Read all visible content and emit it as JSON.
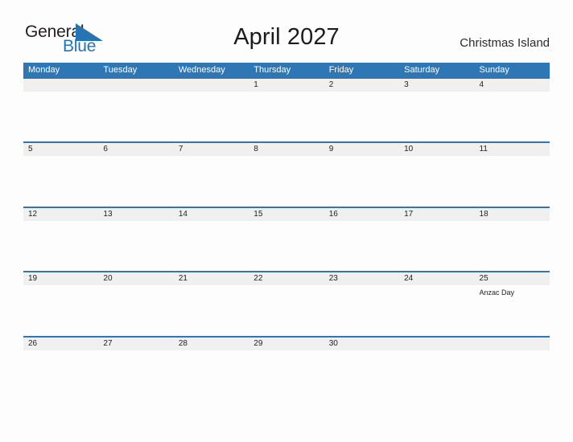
{
  "brand": {
    "name_part1": "General",
    "name_part2": "Blue",
    "flag_icon": "blue-triangle-flag",
    "accent_color": "#2874b2"
  },
  "header": {
    "title": "April 2027",
    "region": "Christmas Island"
  },
  "calendar": {
    "month": "April",
    "year": "2027",
    "header_color": "#2e76b4",
    "band_color": "#f0f0f0",
    "weekdays": [
      "Monday",
      "Tuesday",
      "Wednesday",
      "Thursday",
      "Friday",
      "Saturday",
      "Sunday"
    ],
    "weeks": [
      {
        "days": [
          {
            "number": "",
            "events": []
          },
          {
            "number": "",
            "events": []
          },
          {
            "number": "",
            "events": []
          },
          {
            "number": "1",
            "events": []
          },
          {
            "number": "2",
            "events": []
          },
          {
            "number": "3",
            "events": []
          },
          {
            "number": "4",
            "events": []
          }
        ]
      },
      {
        "days": [
          {
            "number": "5",
            "events": []
          },
          {
            "number": "6",
            "events": []
          },
          {
            "number": "7",
            "events": []
          },
          {
            "number": "8",
            "events": []
          },
          {
            "number": "9",
            "events": []
          },
          {
            "number": "10",
            "events": []
          },
          {
            "number": "11",
            "events": []
          }
        ]
      },
      {
        "days": [
          {
            "number": "12",
            "events": []
          },
          {
            "number": "13",
            "events": []
          },
          {
            "number": "14",
            "events": []
          },
          {
            "number": "15",
            "events": []
          },
          {
            "number": "16",
            "events": []
          },
          {
            "number": "17",
            "events": []
          },
          {
            "number": "18",
            "events": []
          }
        ]
      },
      {
        "days": [
          {
            "number": "19",
            "events": []
          },
          {
            "number": "20",
            "events": []
          },
          {
            "number": "21",
            "events": []
          },
          {
            "number": "22",
            "events": []
          },
          {
            "number": "23",
            "events": []
          },
          {
            "number": "24",
            "events": []
          },
          {
            "number": "25",
            "events": [
              "Anzac Day"
            ]
          }
        ]
      },
      {
        "days": [
          {
            "number": "26",
            "events": []
          },
          {
            "number": "27",
            "events": []
          },
          {
            "number": "28",
            "events": []
          },
          {
            "number": "29",
            "events": []
          },
          {
            "number": "30",
            "events": []
          },
          {
            "number": "",
            "events": []
          },
          {
            "number": "",
            "events": []
          }
        ]
      }
    ]
  }
}
